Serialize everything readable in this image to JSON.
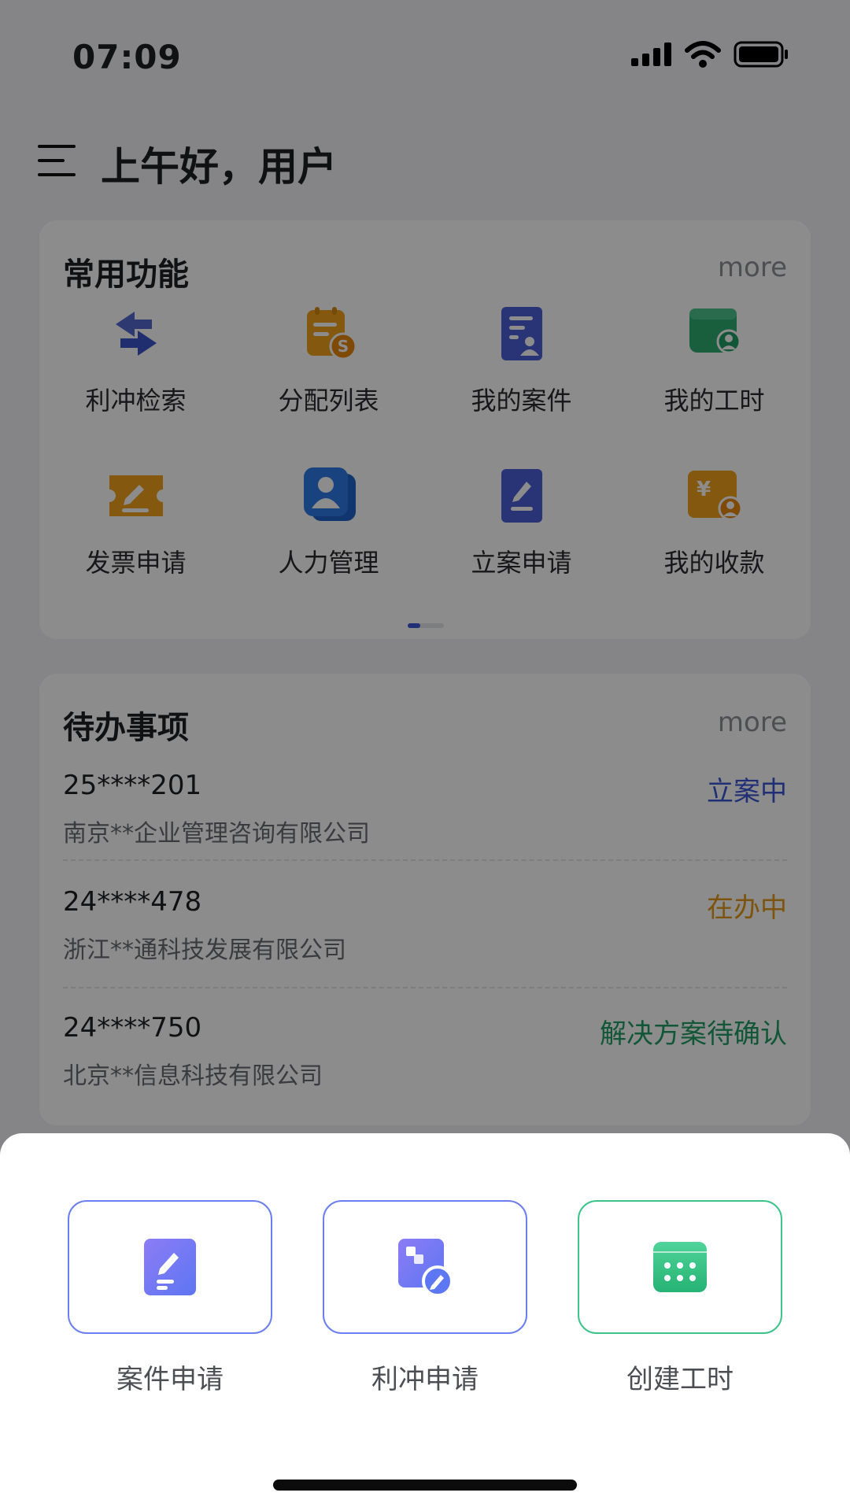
{
  "status": {
    "time": "07:09"
  },
  "header": {
    "greeting": "上午好，用户"
  },
  "functions": {
    "title": "常用功能",
    "more": "more",
    "items": [
      {
        "label": "利冲检索",
        "icon": "swap-arrows-icon"
      },
      {
        "label": "分配列表",
        "icon": "clipboard-dollar-icon"
      },
      {
        "label": "我的案件",
        "icon": "case-document-icon"
      },
      {
        "label": "我的工时",
        "icon": "calendar-user-icon"
      },
      {
        "label": "发票申请",
        "icon": "invoice-ticket-icon"
      },
      {
        "label": "人力管理",
        "icon": "people-cards-icon"
      },
      {
        "label": "立案申请",
        "icon": "edit-document-icon"
      },
      {
        "label": "我的收款",
        "icon": "yen-user-icon"
      }
    ]
  },
  "todo": {
    "title": "待办事项",
    "more": "more",
    "items": [
      {
        "id": "25****201",
        "company": "南京**企业管理咨询有限公司",
        "status": "立案中",
        "status_color": "#3b57d6"
      },
      {
        "id": "24****478",
        "company": "浙江**通科技发展有限公司",
        "status": "在办中",
        "status_color": "#e39a1b"
      },
      {
        "id": "24****750",
        "company": "北京**信息科技有限公司",
        "status": "解决方案待确认",
        "status_color": "#1f9d63"
      }
    ]
  },
  "sheet": {
    "actions": [
      {
        "label": "案件申请",
        "border": "#6b7ff0",
        "icon": "edit-document-icon"
      },
      {
        "label": "利冲申请",
        "border": "#6b7ff0",
        "icon": "conflict-edit-icon"
      },
      {
        "label": "创建工时",
        "border": "#3dc48a",
        "icon": "calendar-icon"
      }
    ]
  },
  "colors": {
    "primary": "#3c58d8",
    "orange": "#f0a11c",
    "green": "#2fae6f"
  }
}
